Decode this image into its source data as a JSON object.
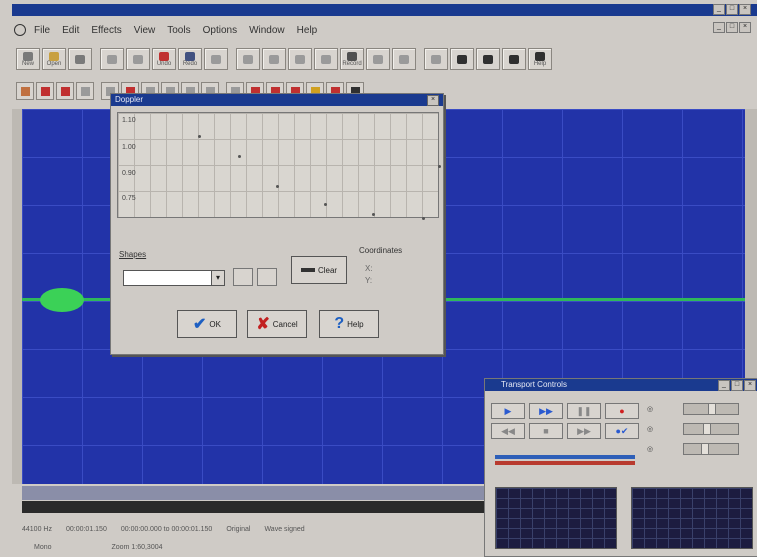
{
  "app": {
    "title": "",
    "menus": [
      "File",
      "Edit",
      "Effects",
      "View",
      "Tools",
      "Options",
      "Window",
      "Help"
    ]
  },
  "toolbar1": [
    {
      "icon": "new-icon",
      "label": "New",
      "color": "#7a7a7a"
    },
    {
      "icon": "open-icon",
      "label": "Open",
      "color": "#c8a040"
    },
    {
      "icon": "save-icon",
      "label": "",
      "color": "#7a7a7a"
    },
    {
      "icon": "cut-icon",
      "label": "",
      "color": "#9a9a9a"
    },
    {
      "icon": "copy-icon",
      "label": "",
      "color": "#9a9a9a"
    },
    {
      "icon": "undo-icon",
      "label": "Undo",
      "color": "#c03030"
    },
    {
      "icon": "redo-icon",
      "label": "Redo",
      "color": "#405080"
    },
    {
      "icon": "paste-icon",
      "label": "",
      "color": "#9a9a9a"
    },
    {
      "icon": "mix-icon",
      "label": "",
      "color": "#9a9a9a"
    },
    {
      "icon": "trim-icon",
      "label": "",
      "color": "#9a9a9a"
    },
    {
      "icon": "select-icon",
      "label": "",
      "color": "#9a9a9a"
    },
    {
      "icon": "zoom-icon",
      "label": "",
      "color": "#9a9a9a"
    },
    {
      "icon": "record-icon",
      "label": "Record",
      "color": "#505050"
    },
    {
      "icon": "blank-icon",
      "label": "",
      "color": "#9a9a9a"
    },
    {
      "icon": "blank-icon",
      "label": "",
      "color": "#9a9a9a"
    },
    {
      "icon": "find-icon",
      "label": "",
      "color": "#9a9a9a"
    },
    {
      "icon": "help-context-icon",
      "label": "",
      "color": "#303030"
    },
    {
      "icon": "help-index-icon",
      "label": "",
      "color": "#303030"
    },
    {
      "icon": "help-topic-icon",
      "label": "",
      "color": "#303030"
    },
    {
      "icon": "help-icon",
      "label": "Help",
      "color": "#303030"
    }
  ],
  "toolbar2": [
    {
      "icon": "effect-1-icon",
      "color": "#c07040"
    },
    {
      "icon": "effect-2-icon",
      "color": "#c03030"
    },
    {
      "icon": "effect-3-icon",
      "color": "#c03030"
    },
    {
      "icon": "effect-4-icon",
      "color": "#9a9a9a"
    },
    {
      "icon": "effect-5-icon",
      "color": "#9a9a9a"
    },
    {
      "icon": "effect-6-icon",
      "color": "#c03030"
    },
    {
      "icon": "effect-7-icon",
      "color": "#9a9a9a"
    },
    {
      "icon": "effect-8-icon",
      "color": "#9a9a9a"
    },
    {
      "icon": "effect-9-icon",
      "color": "#9a9a9a"
    },
    {
      "icon": "effect-10-icon",
      "color": "#9a9a9a"
    },
    {
      "icon": "effect-11-icon",
      "color": "#9a9a9a"
    },
    {
      "icon": "effect-12-icon",
      "color": "#c03030"
    },
    {
      "icon": "effect-13-icon",
      "color": "#c03030"
    },
    {
      "icon": "effect-14-icon",
      "color": "#c03030"
    },
    {
      "icon": "effect-15-icon",
      "color": "#d0a020"
    },
    {
      "icon": "effect-16-icon",
      "color": "#c03030"
    },
    {
      "icon": "effect-17-icon",
      "color": "#303030"
    }
  ],
  "doppler": {
    "title": "Doppler",
    "y_ticks": [
      "1.10",
      "1.00",
      "0.90",
      "0.75"
    ],
    "x_ticks": "",
    "shapes_label": "Shapes",
    "shapes_value": "",
    "clear_label": "Clear",
    "coordinates_label": "Coordinates",
    "coord_x": "X:",
    "coord_y": "Y:",
    "ok_label": "OK",
    "cancel_label": "Cancel",
    "help_label": "Help"
  },
  "transport": {
    "title": "Transport Controls",
    "buttons": [
      {
        "icon": "play-icon",
        "color": "#2a5ad0"
      },
      {
        "icon": "play-loop-icon",
        "color": "#2a5ad0"
      },
      {
        "icon": "pause-icon",
        "color": "#888888"
      },
      {
        "icon": "record-dot-icon",
        "color": "#d02020"
      },
      {
        "icon": "rewind-icon",
        "color": "#888888"
      },
      {
        "icon": "stop-icon",
        "color": "#888888"
      },
      {
        "icon": "forward-icon",
        "color": "#888888"
      },
      {
        "icon": "record-check-icon",
        "color": "#2a5ad0"
      }
    ],
    "sliders": [
      {
        "label": "",
        "position": 0.5
      },
      {
        "label": "",
        "position": 0.4
      },
      {
        "label": "",
        "position": 0.35
      }
    ]
  },
  "status": {
    "sample_rate": "44100 Hz",
    "time": "00:00:01.150",
    "range": "00:00:00.000 to 00:00:01.150",
    "original": "Original",
    "format": "Wave signed",
    "mono": "Mono",
    "zoom": "Zoom 1:60,3004"
  },
  "colors": {
    "wave_bg": "#2233a8",
    "wave_signal": "#3bd157",
    "title_bar": "#1a3a8f"
  }
}
